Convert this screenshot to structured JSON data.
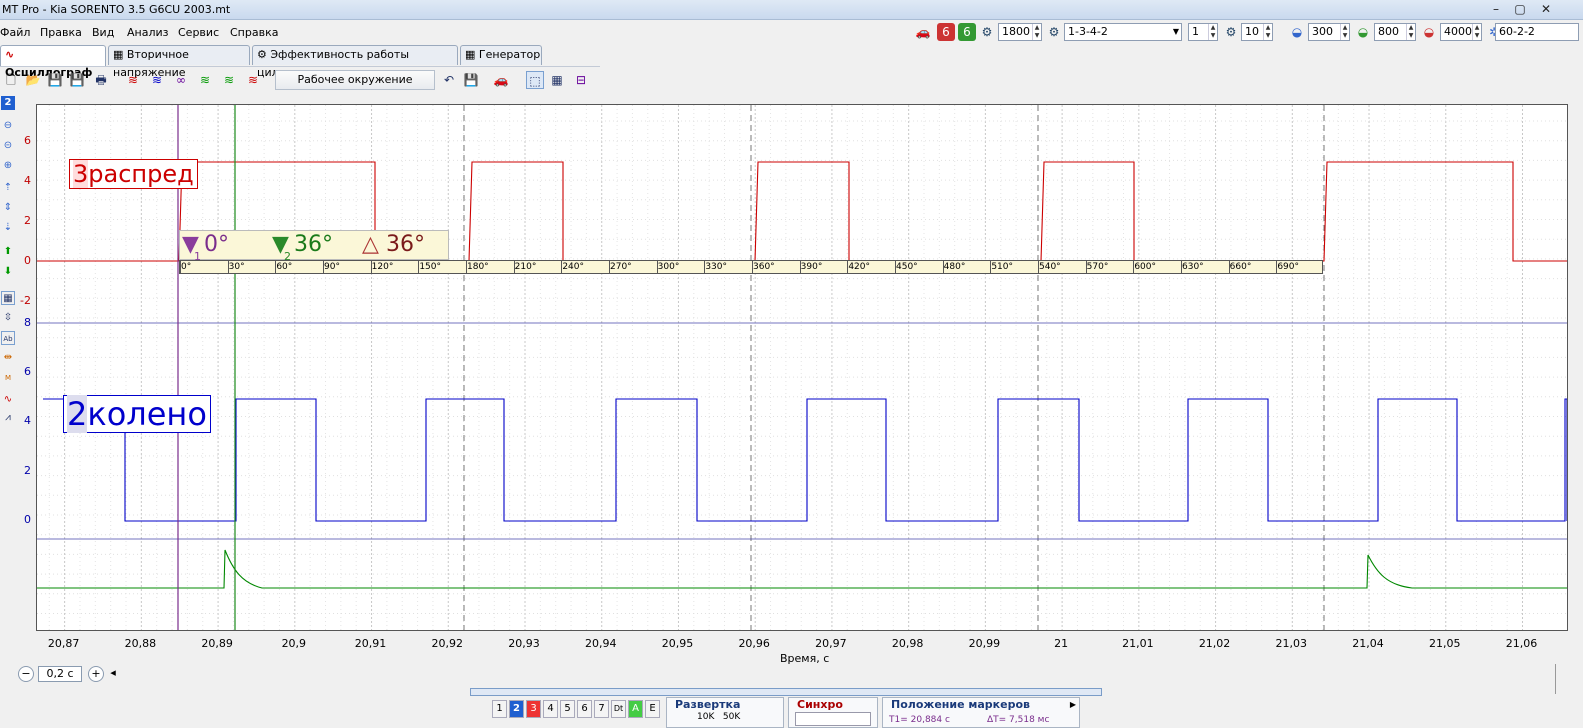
{
  "window": {
    "title": "MT Pro - Kia SORENTO 3.5  G6CU 2003.mt"
  },
  "menu": [
    "Файл",
    "Правка",
    "Вид",
    "Анализ",
    "Сервис",
    "Справка"
  ],
  "topright": {
    "rpm": "1800",
    "firing_order": "1-3-4-2",
    "cylinder": "1",
    "val_a": "10",
    "val_b": "300",
    "val_c": "800",
    "val_d": "4000",
    "wheel": "60-2-2"
  },
  "tabs": [
    "Осциллограф",
    "Вторичное напряжение",
    "Эффективность работы цилиндров",
    "Генератор"
  ],
  "toolbar": {
    "workspace": "Рабочее окружение"
  },
  "channel_tag": "2",
  "channels": {
    "ch3": {
      "number": "3",
      "name": "распред",
      "color": "#cc0000"
    },
    "ch2": {
      "number": "2",
      "name": "колено",
      "color": "#0000c8"
    },
    "ch1": {
      "color": "#008800"
    }
  },
  "y_ticks_top": [
    "6",
    "4",
    "2",
    "0",
    "-2"
  ],
  "y_ticks_mid": [
    "8",
    "6",
    "4",
    "2",
    "0"
  ],
  "markers": {
    "m1_num": "1",
    "m1_value": "0°",
    "m2_num": "2",
    "m2_value": "36°",
    "delta_value": "36°"
  },
  "degree_ticks": [
    "0°",
    "30°",
    "60°",
    "90°",
    "120°",
    "150°",
    "180°",
    "210°",
    "240°",
    "270°",
    "300°",
    "330°",
    "360°",
    "390°",
    "420°",
    "450°",
    "480°",
    "510°",
    "540°",
    "570°",
    "600°",
    "630°",
    "660°",
    "690°"
  ],
  "x_ticks": [
    "20,87",
    "20,88",
    "20,89",
    "20,9",
    "20,91",
    "20,92",
    "20,93",
    "20,94",
    "20,95",
    "20,96",
    "20,97",
    "20,98",
    "20,99",
    "21",
    "21,01",
    "21,02",
    "21,03",
    "21,04",
    "21,05",
    "21,06"
  ],
  "x_axis_label": "Время, с",
  "bottom": {
    "scale": "0,2 с",
    "channel_buttons": [
      "1",
      "2",
      "3",
      "4",
      "5",
      "6",
      "7",
      "Dt",
      "A",
      "E"
    ],
    "sweep_title": "Развертка",
    "sweep_values": "10K   50K",
    "sync_title": "Синхро",
    "markers_title": "Положение маркеров",
    "t1": "T1= 20,884 с",
    "dt": "ΔT= 7,518 мс"
  }
}
